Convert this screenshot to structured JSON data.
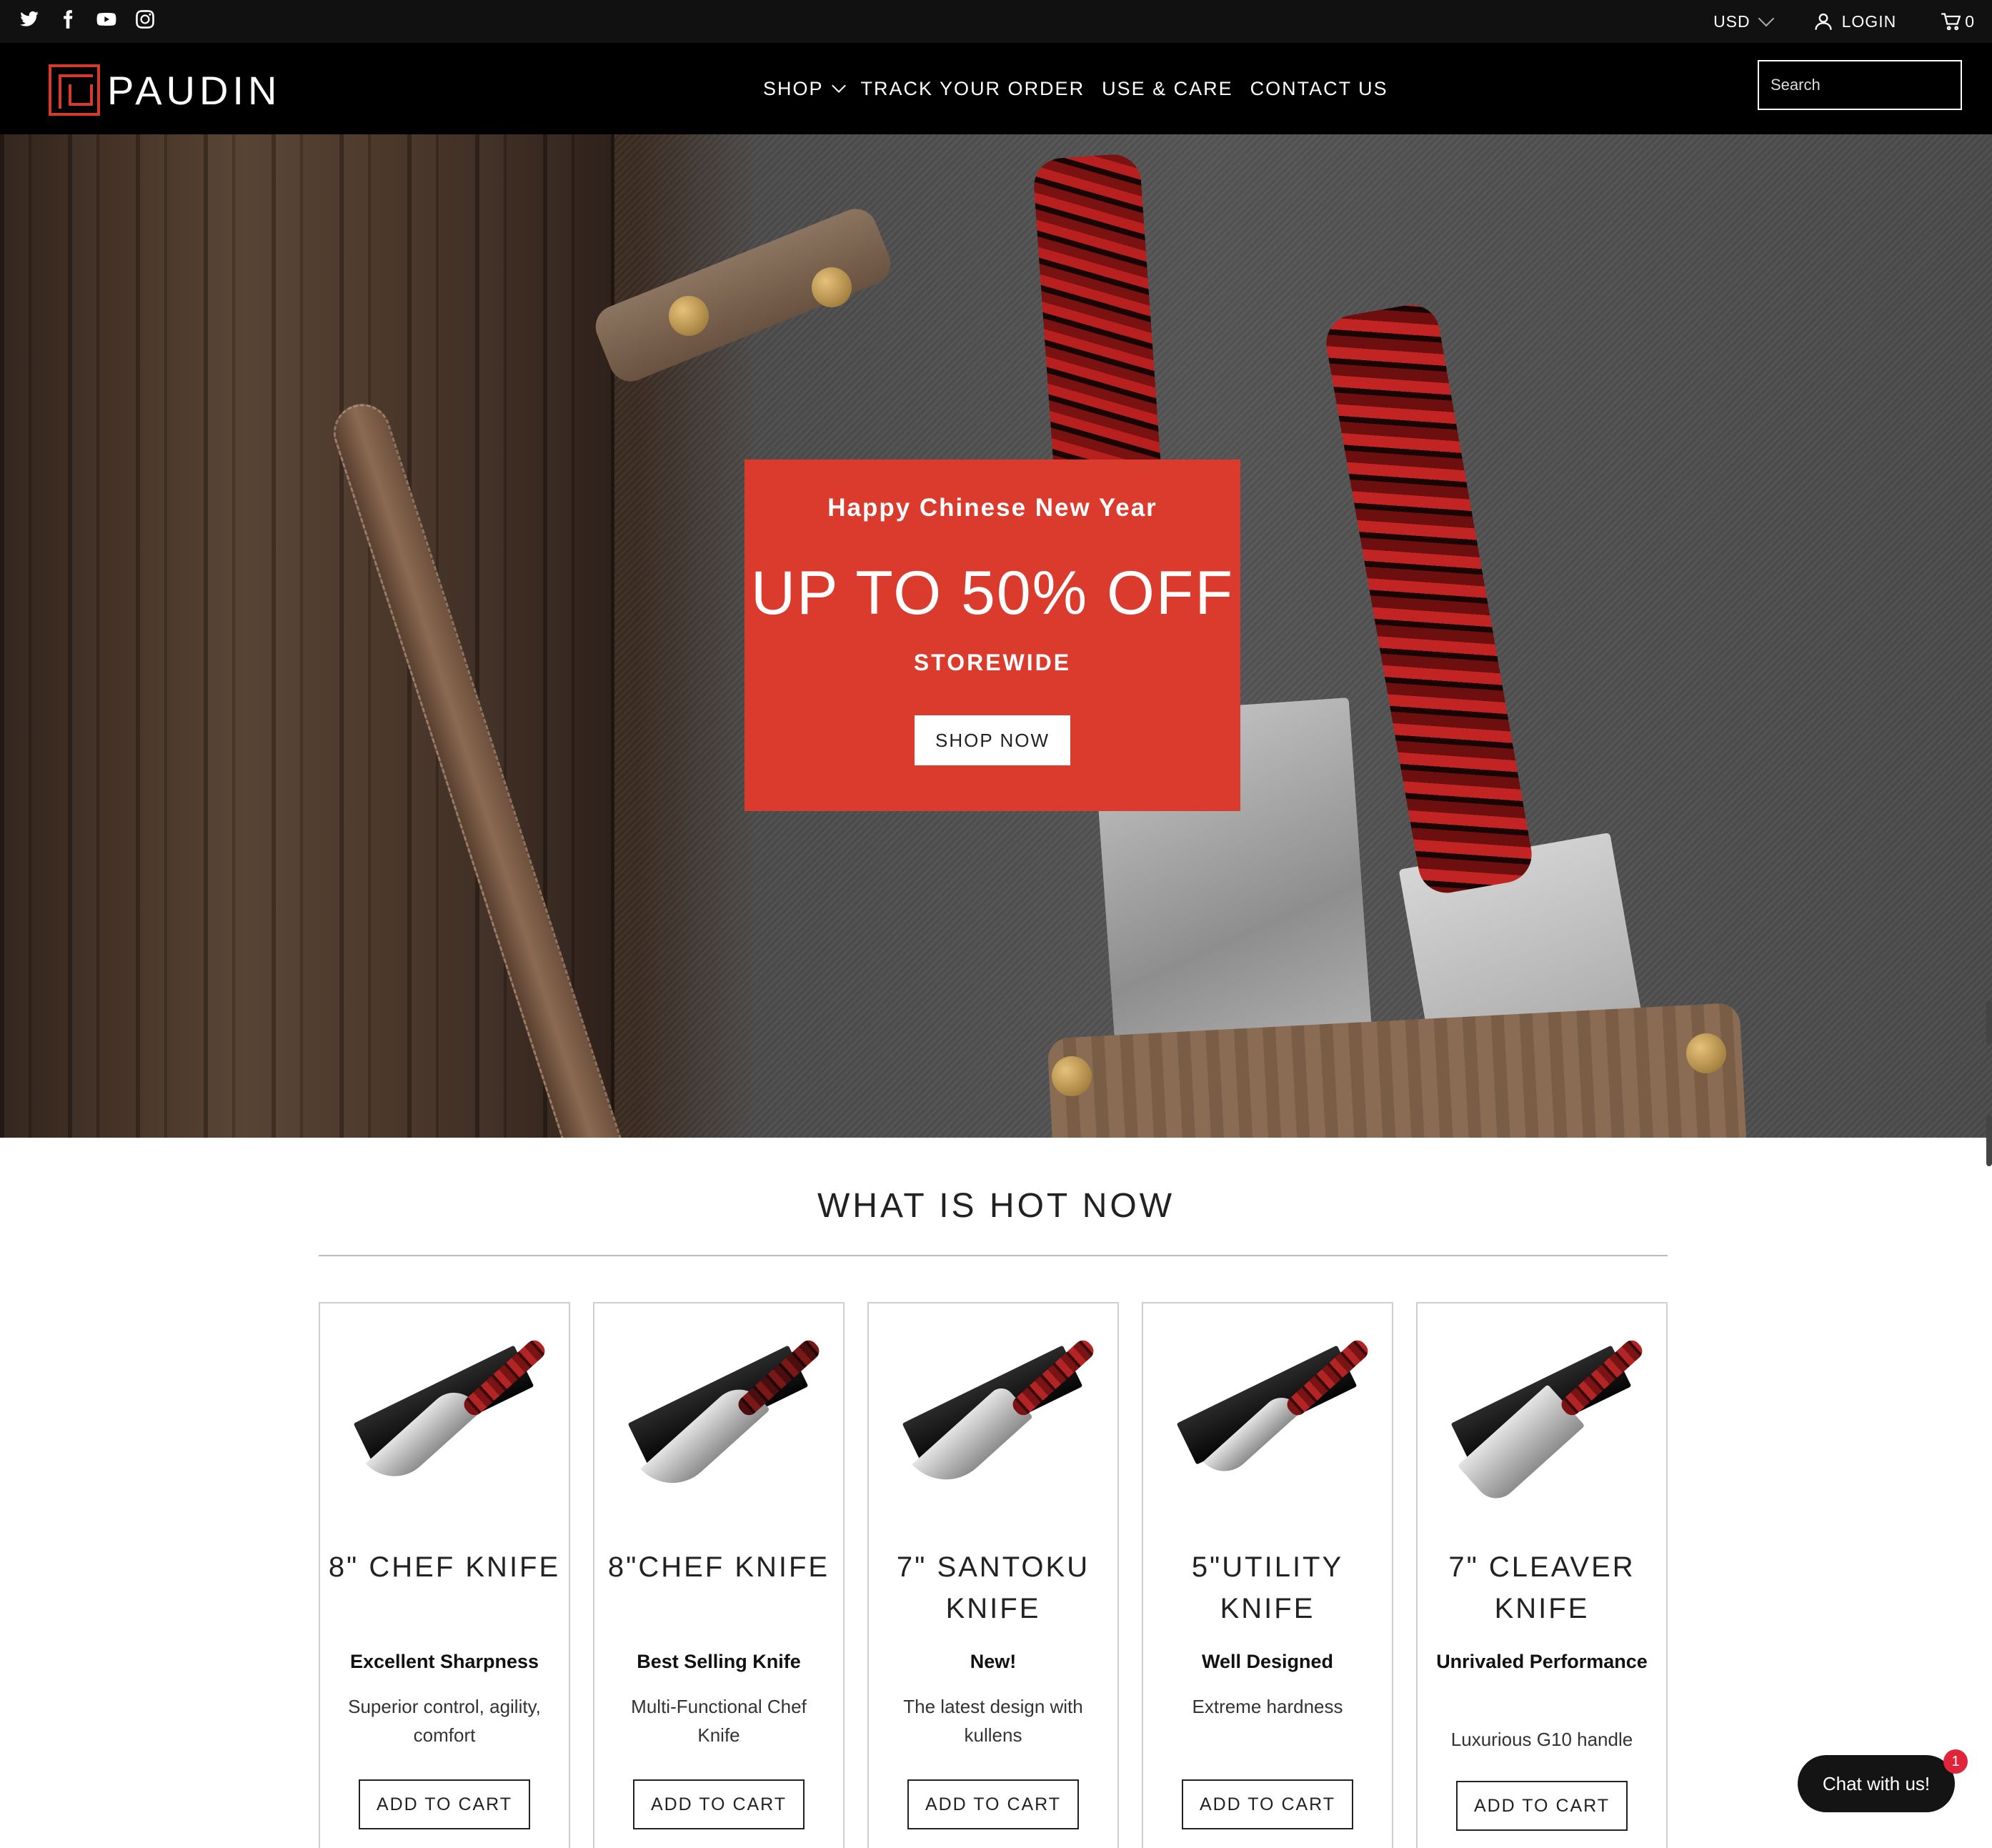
{
  "topbar": {
    "social": [
      "twitter-icon",
      "facebook-icon",
      "youtube-icon",
      "instagram-icon"
    ],
    "currency": "USD",
    "login": "LOGIN",
    "cart_count": "0"
  },
  "header": {
    "brand": "PAUDIN",
    "nav": [
      {
        "label": "SHOP",
        "has_dropdown": true
      },
      {
        "label": "TRACK YOUR ORDER"
      },
      {
        "label": "USE & CARE"
      },
      {
        "label": "CONTACT US"
      }
    ],
    "search_placeholder": "Search"
  },
  "hero": {
    "eyebrow": "Happy Chinese New Year",
    "headline": "UP TO 50% OFF",
    "sub": "STOREWIDE",
    "button": "SHOP NOW"
  },
  "section": {
    "title": "WHAT IS HOT NOW"
  },
  "products": [
    {
      "name": "8\" CHEF KNIFE",
      "tag": "Excellent Sharpness",
      "desc": "Superior control, agility, comfort",
      "button": "ADD TO CART"
    },
    {
      "name": "8\"CHEF KNIFE",
      "tag": "Best Selling Knife",
      "desc": "Multi-Functional Chef Knife",
      "button": "ADD TO CART"
    },
    {
      "name": "7\" SANTOKU KNIFE",
      "tag": "New!",
      "desc": "The latest design with kullens",
      "button": "ADD TO CART"
    },
    {
      "name": "5\"UTILITY KNIFE",
      "tag": "Well Designed",
      "desc": "Extreme hardness",
      "button": "ADD TO CART"
    },
    {
      "name": "7\" CLEAVER KNIFE",
      "tag": "Unrivaled Performance",
      "desc": "Luxurious G10 handle",
      "button": "ADD TO CART"
    }
  ],
  "chat": {
    "label": "Chat with us!",
    "badge": "1"
  },
  "colors": {
    "accent": "#db3b2d",
    "topbar": "#111111",
    "header": "#000000"
  }
}
